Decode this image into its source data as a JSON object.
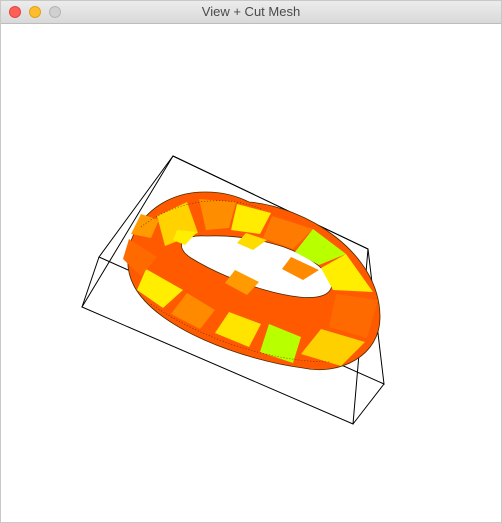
{
  "window": {
    "title": "View + Cut Mesh"
  },
  "scene": {
    "object": "torus",
    "colors": {
      "orange": "#ff7a00",
      "red_orange": "#ff4d00",
      "yellow": "#ffee00",
      "lime": "#b8ff00",
      "edge": "#000000",
      "box": "#000000"
    }
  }
}
